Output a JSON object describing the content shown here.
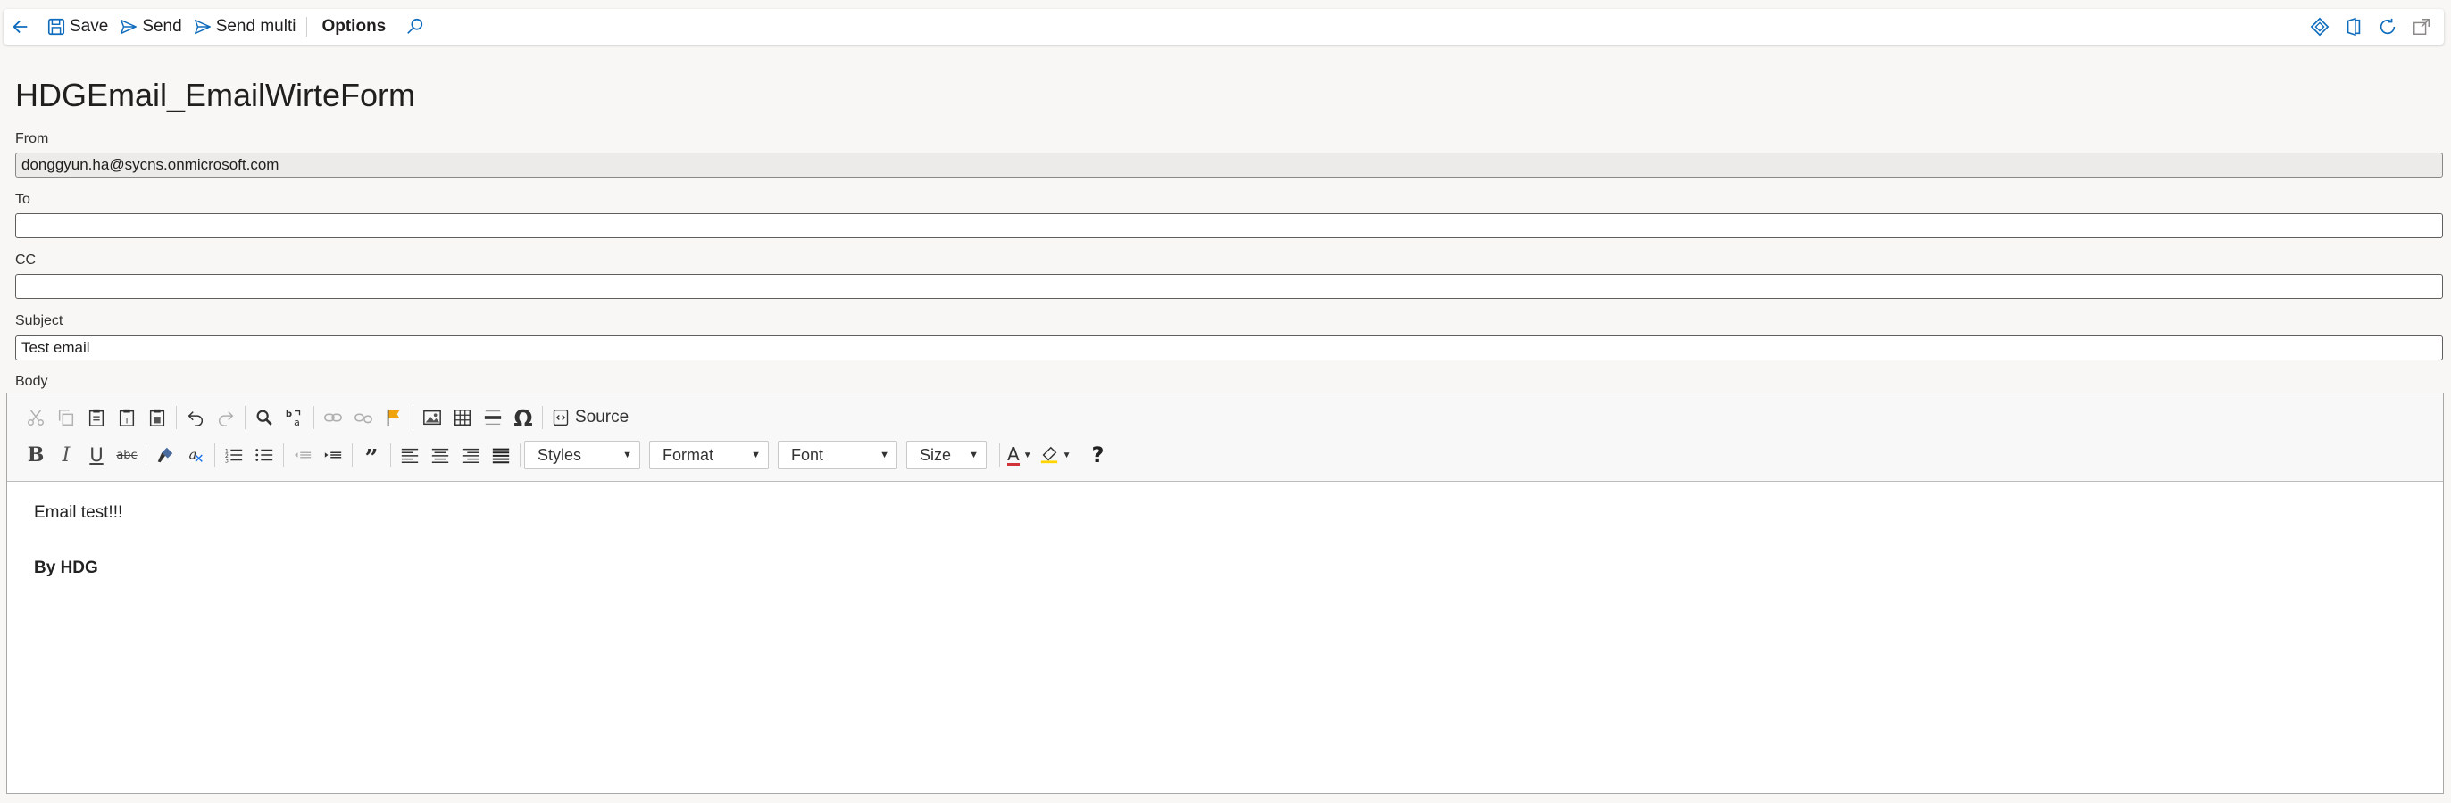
{
  "toolbar": {
    "save_label": "Save",
    "send_label": "Send",
    "send_multi_label": "Send multi",
    "options_label": "Options"
  },
  "page": {
    "title": "HDGEmail_EmailWirteForm"
  },
  "form": {
    "from_label": "From",
    "from_value": "donggyun.ha@sycns.onmicrosoft.com",
    "to_label": "To",
    "to_value": "",
    "cc_label": "CC",
    "cc_value": "",
    "subject_label": "Subject",
    "subject_value": "Test email",
    "body_label": "Body"
  },
  "editor": {
    "source_label": "Source",
    "styles_label": "Styles",
    "format_label": "Format",
    "font_label": "Font",
    "size_label": "Size",
    "help_label": "?",
    "content_line1": "Email test!!!",
    "content_line2": "By HDG"
  },
  "colors": {
    "accent": "#0f6cbd",
    "page_bg": "#f8f7f6",
    "flag_orange": "#f0a30a",
    "font_color_red": "#d13438",
    "highlight_yellow": "#ffd400"
  }
}
